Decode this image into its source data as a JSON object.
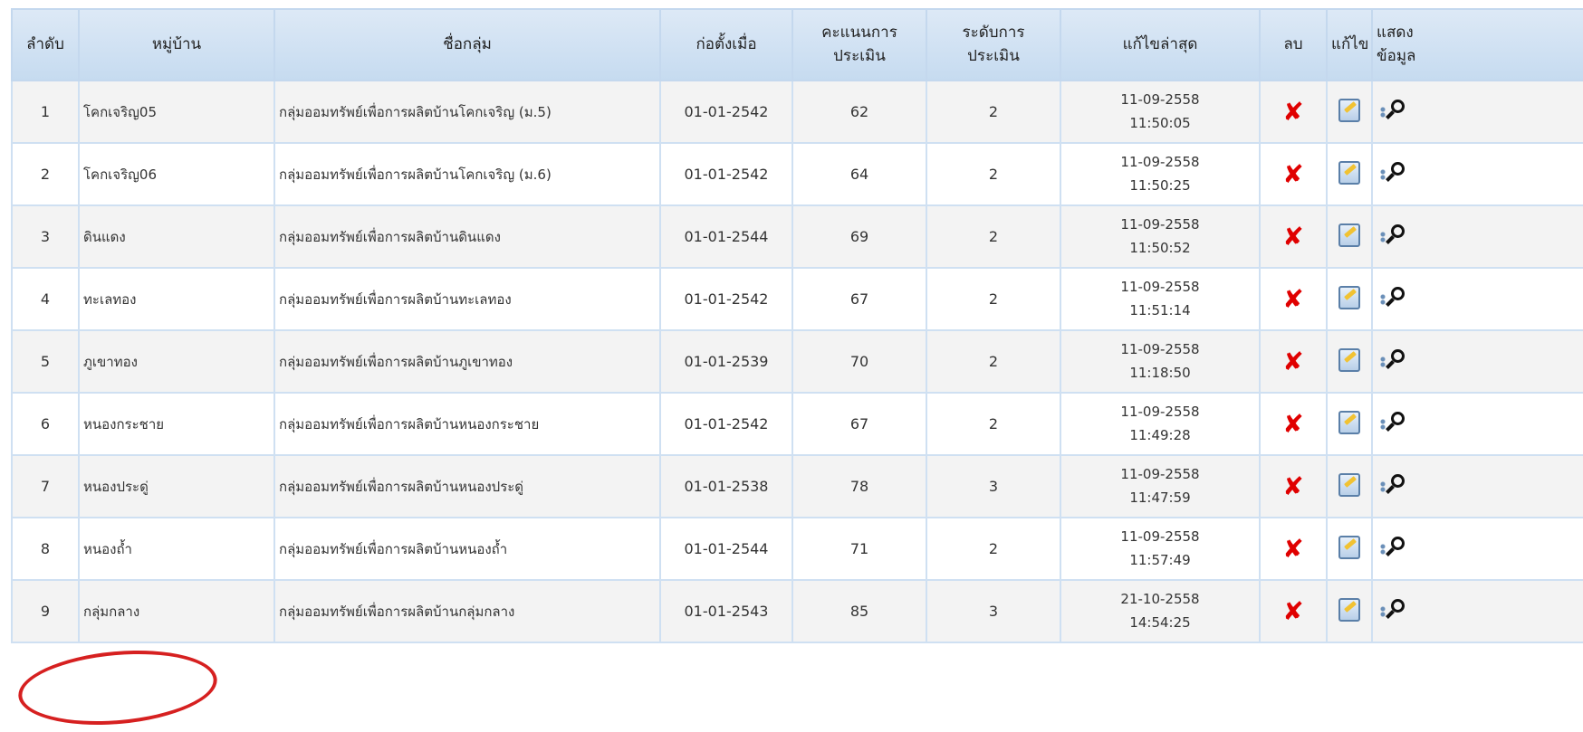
{
  "headers": {
    "order": "ลำดับ",
    "village": "หมู่บ้าน",
    "group_name": "ชื่อกลุ่ม",
    "founded": "ก่อตั้งเมื่อ",
    "score_l1": "คะแนนการ",
    "score_l2": "ประเมิน",
    "level_l1": "ระดับการ",
    "level_l2": "ประเมิน",
    "last_edit": "แก้ไขล่าสุด",
    "delete": "ลบ",
    "edit": "แก้ไข",
    "show_l1": "แสดง",
    "show_l2": "ข้อมูล"
  },
  "rows": [
    {
      "order": "1",
      "village": "โคกเจริญ05",
      "group": "กลุ่มออมทรัพย์เพื่อการผลิตบ้านโคกเจริญ (ม.5)",
      "founded": "01-01-2542",
      "score": "62",
      "level": "2",
      "date": "11-09-2558",
      "time": "11:50:05"
    },
    {
      "order": "2",
      "village": "โคกเจริญ06",
      "group": "กลุ่มออมทรัพย์เพื่อการผลิตบ้านโคกเจริญ (ม.6)",
      "founded": "01-01-2542",
      "score": "64",
      "level": "2",
      "date": "11-09-2558",
      "time": "11:50:25"
    },
    {
      "order": "3",
      "village": "ดินแดง",
      "group": "กลุ่มออมทรัพย์เพื่อการผลิตบ้านดินแดง",
      "founded": "01-01-2544",
      "score": "69",
      "level": "2",
      "date": "11-09-2558",
      "time": "11:50:52"
    },
    {
      "order": "4",
      "village": "ทะเลทอง",
      "group": "กลุ่มออมทรัพย์เพื่อการผลิตบ้านทะเลทอง",
      "founded": "01-01-2542",
      "score": "67",
      "level": "2",
      "date": "11-09-2558",
      "time": "11:51:14"
    },
    {
      "order": "5",
      "village": "ภูเขาทอง",
      "group": "กลุ่มออมทรัพย์เพื่อการผลิตบ้านภูเขาทอง",
      "founded": "01-01-2539",
      "score": "70",
      "level": "2",
      "date": "11-09-2558",
      "time": "11:18:50"
    },
    {
      "order": "6",
      "village": "หนองกระชาย",
      "group": "กลุ่มออมทรัพย์เพื่อการผลิตบ้านหนองกระชาย",
      "founded": "01-01-2542",
      "score": "67",
      "level": "2",
      "date": "11-09-2558",
      "time": "11:49:28"
    },
    {
      "order": "7",
      "village": "หนองประดู่",
      "group": "กลุ่มออมทรัพย์เพื่อการผลิตบ้านหนองประดู่",
      "founded": "01-01-2538",
      "score": "78",
      "level": "3",
      "date": "11-09-2558",
      "time": "11:47:59"
    },
    {
      "order": "8",
      "village": "หนองถ้ำ",
      "group": "กลุ่มออมทรัพย์เพื่อการผลิตบ้านหนองถ้ำ",
      "founded": "01-01-2544",
      "score": "71",
      "level": "2",
      "date": "11-09-2558",
      "time": "11:57:49"
    },
    {
      "order": "9",
      "village": "กลุ่มกลาง",
      "group": "กลุ่มออมทรัพย์เพื่อการผลิตบ้านกลุ่มกลาง",
      "founded": "01-01-2543",
      "score": "85",
      "level": "3",
      "date": "21-10-2558",
      "time": "14:54:25"
    }
  ],
  "icons": {
    "delete": "delete-x-icon",
    "edit": "edit-pencil-icon",
    "view": "view-magnifier-icon"
  },
  "colors": {
    "header_bg": "#c6dbf0",
    "delete_red": "#e00000",
    "highlight_circle": "#d62020"
  }
}
